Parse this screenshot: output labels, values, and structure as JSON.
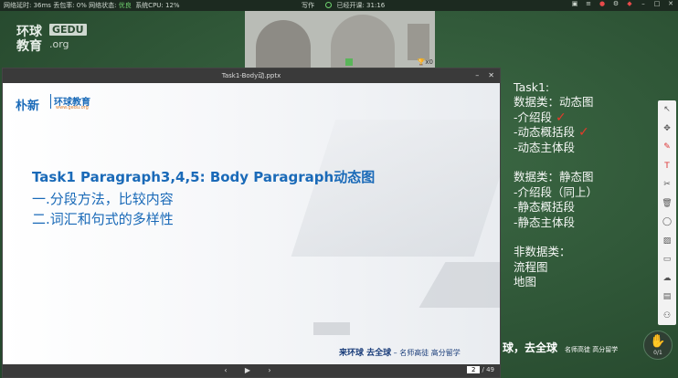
{
  "status_bar": {
    "latency_label": "网络延时: 36ms",
    "loss_label": "丢包率: 0%",
    "network_label": "网络状态:",
    "network_value": "优良",
    "cpu_label": "系统CPU: 12%",
    "write_label": "写作",
    "elapsed_label": "已经开课: 31:16"
  },
  "logo": {
    "line1": "环球",
    "gedu": "GEDU",
    "line2": "教育",
    "org": ".org"
  },
  "camera": {
    "reward_count": "x0"
  },
  "ppt": {
    "window_title": "Task1-Body动.pptx",
    "brand_cn": "朴新",
    "brand_name": "环球教育",
    "brand_url": "www.gedu.org",
    "title": "Task1 Paragraph3,4,5: Body Paragraph动态图",
    "point1": "一.分段方法，比较内容",
    "point2": "二.词汇和句式的多样性",
    "footer_main": "来环球  去全球",
    "footer_sub": " – 名师高徒  高分留学",
    "current_page": "2",
    "total_pages": "/ 49"
  },
  "notes": [
    {
      "text": "Task1:",
      "check": false
    },
    {
      "text": "数据类：动态图",
      "check": false
    },
    {
      "text": "-介绍段",
      "check": true
    },
    {
      "text": "-动态概括段",
      "check": true
    },
    {
      "text": "-动态主体段",
      "check": false
    },
    {
      "text": "",
      "check": false
    },
    {
      "text": "数据类：静态图",
      "check": false
    },
    {
      "text": "-介绍段（同上）",
      "check": false
    },
    {
      "text": "-静态概括段",
      "check": false
    },
    {
      "text": "-静态主体段",
      "check": false
    },
    {
      "text": "",
      "check": false
    },
    {
      "text": "非数据类：",
      "check": false
    },
    {
      "text": "流程图",
      "check": false
    },
    {
      "text": "地图",
      "check": false
    }
  ],
  "slogan": {
    "main": "球，去全球",
    "sub": "名师高徒 高分留学"
  },
  "hand": {
    "count": "0/1"
  },
  "tools": [
    "cursor-icon",
    "move-icon",
    "pen-icon",
    "text-icon",
    "scissors-icon",
    "trash-icon",
    "circle-icon",
    "image-icon",
    "chat-icon",
    "cloud-icon",
    "box-icon",
    "group-icon"
  ]
}
